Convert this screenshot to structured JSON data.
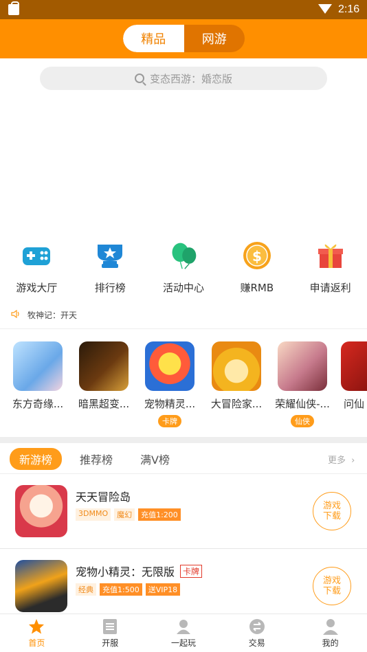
{
  "status_bar": {
    "time": "2:16"
  },
  "header": {
    "segments": [
      {
        "label": "精品",
        "active": true
      },
      {
        "label": "网游",
        "active": false
      }
    ]
  },
  "search": {
    "placeholder": "变态西游：婚恋版"
  },
  "quick_entries": [
    {
      "label": "游戏大厅",
      "icon": "gamepad-icon"
    },
    {
      "label": "排行榜",
      "icon": "trophy-icon"
    },
    {
      "label": "活动中心",
      "icon": "balloons-icon"
    },
    {
      "label": "赚RMB",
      "icon": "coin-icon"
    },
    {
      "label": "申请返利",
      "icon": "gift-icon"
    }
  ],
  "notice": {
    "text": "牧神记：开天"
  },
  "featured_games": [
    {
      "name": "东方奇缘...",
      "tag": ""
    },
    {
      "name": "暗黑超变...",
      "tag": ""
    },
    {
      "name": "宠物精灵...",
      "tag": "卡牌"
    },
    {
      "name": "大冒险家...",
      "tag": ""
    },
    {
      "name": "荣耀仙侠-...",
      "tag": "仙侠"
    },
    {
      "name": "问仙",
      "tag": ""
    }
  ],
  "rank_tabs": [
    {
      "label": "新游榜",
      "active": true
    },
    {
      "label": "推荐榜",
      "active": false
    },
    {
      "label": "满V榜",
      "active": false
    }
  ],
  "more_label": "更多",
  "game_list": [
    {
      "title": "天天冒险岛",
      "badge": "",
      "tags": [
        {
          "text": "3DMMO",
          "style": "light"
        },
        {
          "text": "魔幻",
          "style": "light"
        },
        {
          "text": "充值1:200",
          "style": "solid"
        }
      ],
      "download_label_1": "游戏",
      "download_label_2": "下载"
    },
    {
      "title": "宠物小精灵：无限版",
      "badge": "卡牌",
      "tags": [
        {
          "text": "经典",
          "style": "light"
        },
        {
          "text": "充值1:500",
          "style": "solid"
        },
        {
          "text": "送VIP18",
          "style": "solid"
        }
      ],
      "download_label_1": "游戏",
      "download_label_2": "下载"
    }
  ],
  "bottom_nav": [
    {
      "label": "首页",
      "icon": "star-icon",
      "active": true
    },
    {
      "label": "开服",
      "icon": "list-icon",
      "active": false
    },
    {
      "label": "一起玩",
      "icon": "group-icon",
      "active": false
    },
    {
      "label": "交易",
      "icon": "exchange-icon",
      "active": false
    },
    {
      "label": "我的",
      "icon": "profile-icon",
      "active": false
    }
  ],
  "colors": {
    "brand": "#ff8f00",
    "status_bar": "#a25a00",
    "accent": "#ff9c1a"
  }
}
